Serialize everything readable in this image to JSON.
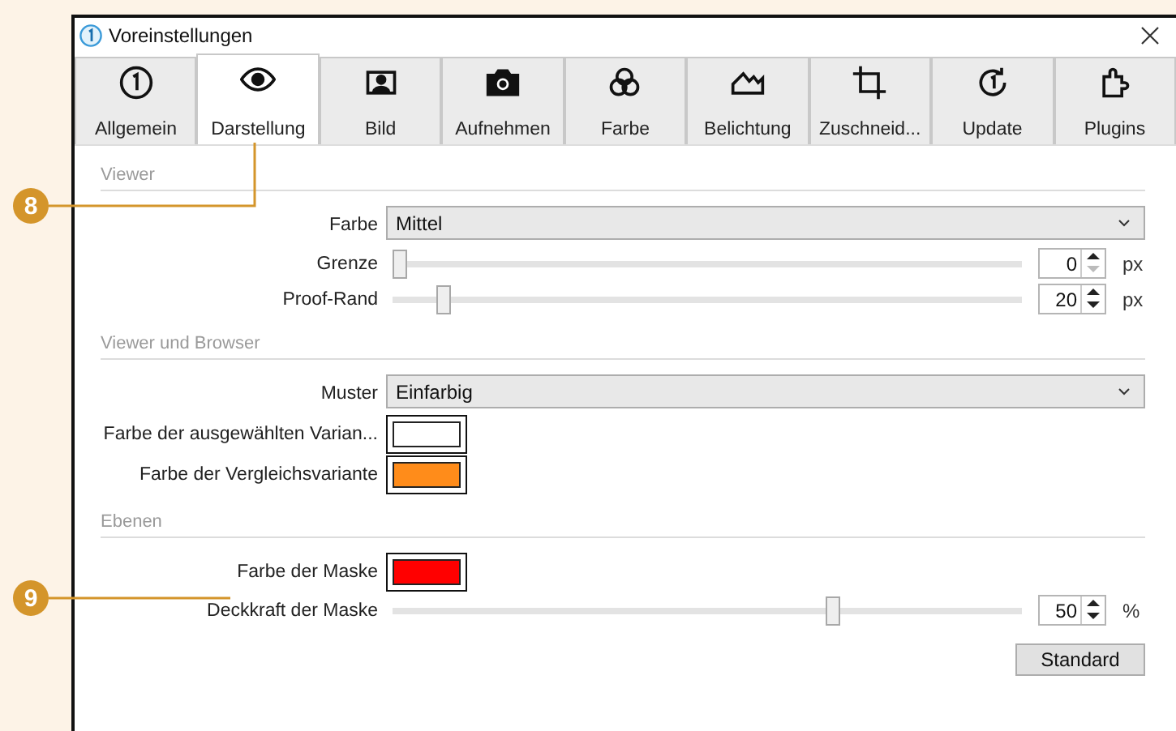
{
  "window": {
    "title": "Voreinstellungen"
  },
  "tabs": [
    {
      "label": "Allgemein",
      "selected": false
    },
    {
      "label": "Darstellung",
      "selected": true
    },
    {
      "label": "Bild",
      "selected": false
    },
    {
      "label": "Aufnehmen",
      "selected": false
    },
    {
      "label": "Farbe",
      "selected": false
    },
    {
      "label": "Belichtung",
      "selected": false
    },
    {
      "label": "Zuschneid...",
      "selected": false
    },
    {
      "label": "Update",
      "selected": false
    },
    {
      "label": "Plugins",
      "selected": false
    }
  ],
  "sections": [
    {
      "title": "Viewer",
      "rows": [
        {
          "kind": "dropdown",
          "label": "Farbe",
          "value": "Mittel"
        },
        {
          "kind": "slider",
          "label": "Grenze",
          "level": 0,
          "value": "0",
          "unit": "px",
          "down_disabled": true
        },
        {
          "kind": "slider",
          "label": "Proof-Rand",
          "level": 0.07,
          "value": "20",
          "unit": "px",
          "down_disabled": false
        }
      ]
    },
    {
      "title": "Viewer und Browser",
      "rows": [
        {
          "kind": "dropdown",
          "label": "Muster",
          "value": "Einfarbig"
        },
        {
          "kind": "swatch",
          "label": "Farbe der ausgewählten Varian...",
          "color": "#ffffff"
        },
        {
          "kind": "swatch",
          "label": "Farbe der Vergleichsvariante",
          "color": "#ff8c1a"
        }
      ]
    },
    {
      "title": "Ebenen",
      "rows": [
        {
          "kind": "swatch",
          "label": "Farbe der Maske",
          "color": "#ff0000"
        },
        {
          "kind": "slider",
          "label": "Deckkraft der Maske",
          "level": 0.705,
          "value": "50",
          "unit": "%",
          "down_disabled": false
        }
      ]
    }
  ],
  "buttons": [
    "Standard"
  ],
  "callouts": [
    "8",
    "9"
  ]
}
